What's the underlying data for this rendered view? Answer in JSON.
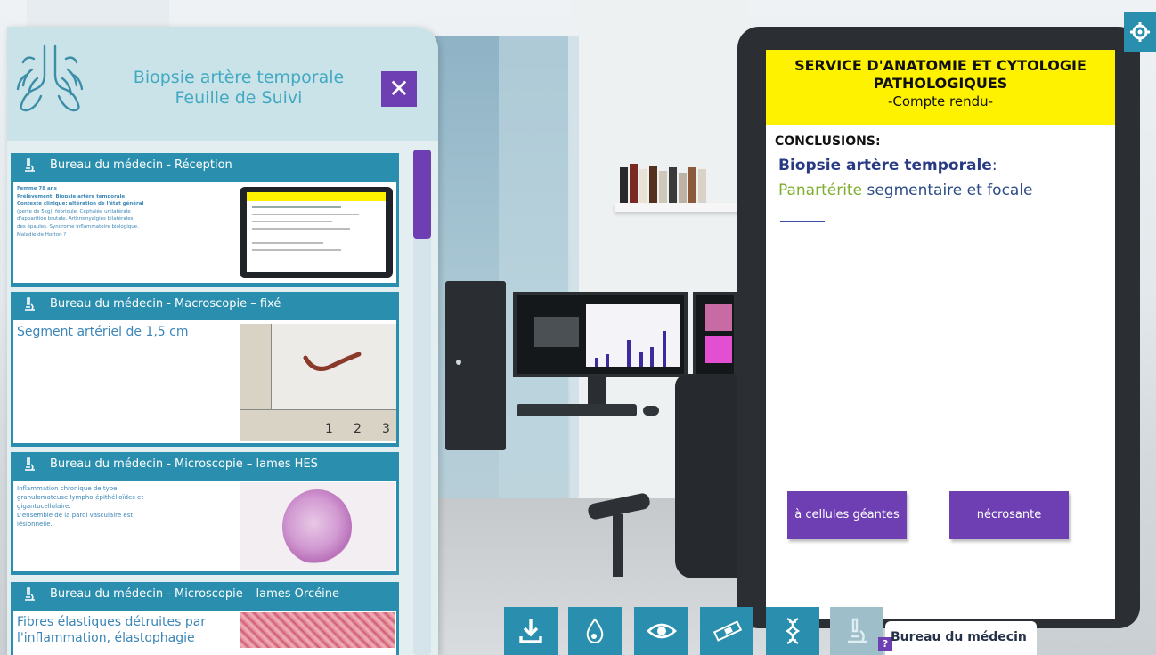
{
  "panel": {
    "title_line1": "Biopsie artère temporale",
    "title_line2": "Feuille de Suivi",
    "close_label": "✕"
  },
  "cards": [
    {
      "title": "Bureau du médecin - Réception",
      "lines": [
        "Femme 78 ans",
        "Prélèvement: Biopsie artère temporale",
        "Contexte clinique: altération de l'état général",
        "(perte de 5kg), fébricule. Céphalée unilatérale",
        "d'apparition brutale. Arthromyalgies bilatérales",
        "des épaules. Syndrome inflammatoire biologique.",
        "Maladie de Horton ?"
      ]
    },
    {
      "title": "Bureau du médecin - Macroscopie – fixé",
      "lines": [
        "Segment artériel de 1,5 cm"
      ],
      "ruler_marks": [
        "1",
        "2",
        "3"
      ]
    },
    {
      "title": "Bureau du médecin - Microscopie – lames HES",
      "lines": [
        "Inflammation chronique de type",
        "granulomateuse lympho-épithélioïdes et",
        "gigantocellulaire.",
        "L'ensemble de la paroi vasculaire est",
        "lésionnelle."
      ]
    },
    {
      "title": "Bureau du médecin - Microscopie – lames Orcéine",
      "lines": [
        "Fibres élastiques détruites par",
        "l'inflammation, élastophagie"
      ]
    }
  ],
  "report": {
    "header_line1": "SERVICE D'ANATOMIE ET CYTOLOGIE",
    "header_line2": "PATHOLOGIQUES",
    "header_line3": "-Compte rendu-",
    "conclusions_label": "CONCLUSIONS:",
    "diagnosis_title": "Biopsie artère temporale",
    "diagnosis_colon": ":",
    "diagnosis_word1": "Panartérite",
    "diagnosis_rest": " segmentaire et focale",
    "options": [
      "à cellules géantes",
      "nécrosante"
    ]
  },
  "toolbar": {
    "tools": [
      "download-icon",
      "drop-icon",
      "eye-icon",
      "slide-icon",
      "dna-icon",
      "microscope-icon"
    ],
    "help_label": "?",
    "location_label": "Bureau du médecin"
  },
  "colors": {
    "accent_teal": "#2a8fae",
    "accent_purple": "#6d3fb2",
    "report_header": "#fff200",
    "text_blue": "#3b86b7"
  }
}
